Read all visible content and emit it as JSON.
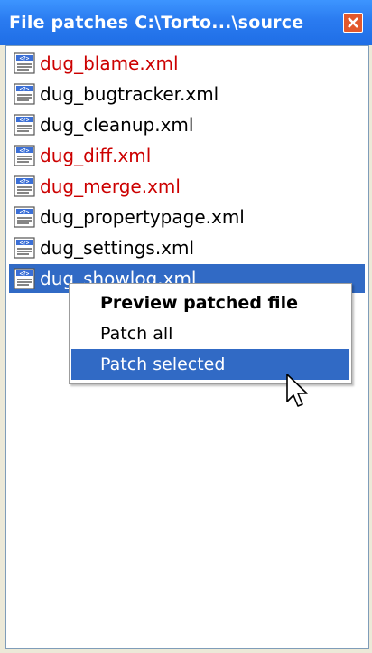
{
  "window": {
    "title": "File patches  C:\\Torto...\\source",
    "close_icon": "close-icon",
    "colors": {
      "titlebar": "#2a7bf0",
      "close": "#e2582c",
      "selection": "#316ac5",
      "modified_text": "#cc0000"
    }
  },
  "files": [
    {
      "name": "dug_blame.xml",
      "state": "modified",
      "icon": "xml-file-icon"
    },
    {
      "name": "dug_bugtracker.xml",
      "state": "normal",
      "icon": "xml-file-icon"
    },
    {
      "name": "dug_cleanup.xml",
      "state": "normal",
      "icon": "xml-file-icon"
    },
    {
      "name": "dug_diff.xml",
      "state": "modified",
      "icon": "xml-file-icon"
    },
    {
      "name": "dug_merge.xml",
      "state": "modified",
      "icon": "xml-file-icon"
    },
    {
      "name": "dug_propertypage.xml",
      "state": "normal",
      "icon": "xml-file-icon"
    },
    {
      "name": "dug_settings.xml",
      "state": "normal",
      "icon": "xml-file-icon"
    },
    {
      "name": "dug_showlog.xml",
      "state": "selected",
      "icon": "xml-file-icon"
    }
  ],
  "context_menu": {
    "items": [
      {
        "label": "Preview patched file",
        "default": true,
        "highlighted": false
      },
      {
        "label": "Patch all",
        "default": false,
        "highlighted": false
      },
      {
        "label": "Patch selected",
        "default": false,
        "highlighted": true
      }
    ]
  },
  "cursor_icon": "arrow-cursor-icon"
}
